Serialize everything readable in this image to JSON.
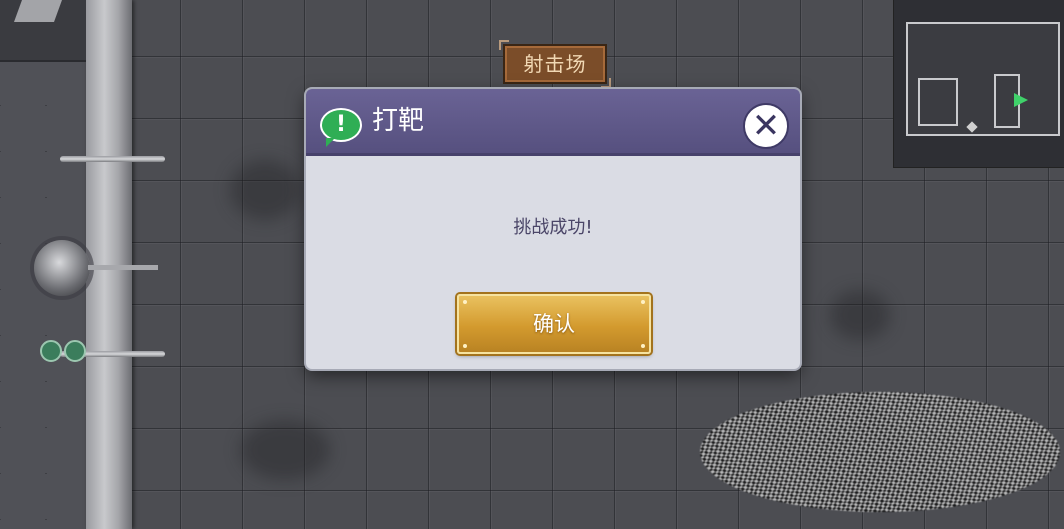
{
  "scene": {
    "location_sign": "射击场"
  },
  "dialog": {
    "title": "打靶",
    "message": "挑战成功!",
    "confirm_label": "确认",
    "close_symbol": "✕",
    "alert_symbol": "!"
  },
  "icons": {
    "alert": "exclamation-speech-icon",
    "close": "close-icon",
    "player_marker": "player-arrow-icon"
  },
  "colors": {
    "dialog_header": "#5c5688",
    "dialog_body": "#dadce4",
    "confirm_button": "#d39a2e",
    "alert_icon": "#2fae55",
    "message_text": "#4b4668"
  }
}
